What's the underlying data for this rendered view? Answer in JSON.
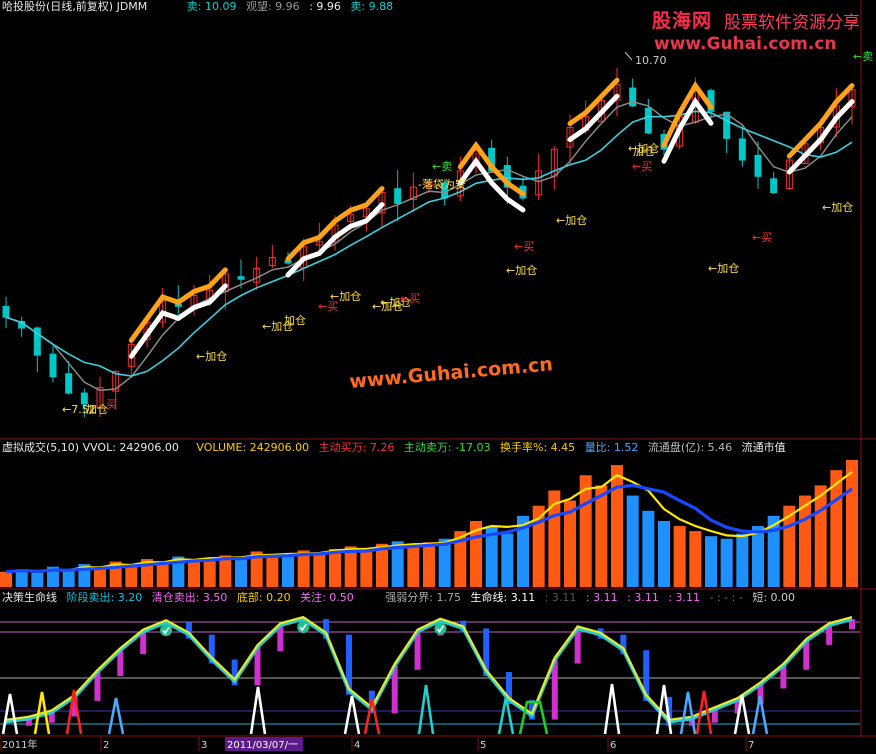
{
  "header": {
    "title": "哈投股份(日线,前复权) JDMM",
    "sell_label": "卖: 10.09",
    "watch_label": "观望: 9.96",
    "mid_label": ": 9.96",
    "sell2_label": "卖: 9.88"
  },
  "watermark": {
    "logo": "股海网",
    "tagline": "股票软件资源分享",
    "url": "www.Guhai.com.cn"
  },
  "main_panel": {
    "high_label": "10.70",
    "center_watermark": "www.Guhai.com.cn",
    "annotations": [
      "←7.52",
      "加仓",
      "买",
      "←加仓",
      "←加仓",
      "加仓",
      "←加仓",
      "←买",
      "←加仓",
      "←加仓",
      "←买",
      "←加仓",
      "←买",
      "←加仓",
      "←加仓",
      "←卖",
      "-落袋为安",
      "加仓",
      "←买",
      "←加仓",
      "←买",
      "←加仓",
      "←卖"
    ],
    "colors": {
      "up": "#ff2a2a",
      "down": "#00c8c8",
      "ma_cyan": "#3ad0e0",
      "ma_gray": "#8a8a8a",
      "orange": "#ffa21a",
      "white": "#ffffff"
    }
  },
  "volume_panel": {
    "title": "虚拟成交(5,10) VVOL: 242906.00",
    "volume": "VOLUME: 242906.00",
    "active_buy": "主动买万: 7.26",
    "active_sell": "主动卖万: -17.03",
    "turnover": "换手率%: 4.45",
    "vol_ratio": "量比: 1.52",
    "float_shares": "流通盘(亿): 5.46",
    "float_cap": "流通市值"
  },
  "life_panel": {
    "title": "决策生命线",
    "stage_sell": "阶段卖出: 3.20",
    "clear_sell": "清仓卖出: 3.50",
    "bottom": "底部: 0.20",
    "watch": "关注: 0.50",
    "strength": "强弱分界: 1.75",
    "lifeline": "生命线: 3.11",
    "v1": ": 3.11",
    "v2": ": 3.11",
    "v3": ": 3.11",
    "v4": ": 3.11",
    "dashes": "- : - : -",
    "short": "短: 0.00"
  },
  "x_axis": {
    "labels": [
      "2011年",
      "2",
      "3",
      "2011/03/07/一",
      "4",
      "5",
      "6",
      "7"
    ]
  },
  "chart_data": {
    "type": "candlestick",
    "price_range": [
      7.3,
      11.0
    ],
    "high": 10.7,
    "low": 7.52,
    "close_samples": [
      8.35,
      8.25,
      8.0,
      7.8,
      7.65,
      7.55,
      7.7,
      7.85,
      8.1,
      8.3,
      8.5,
      8.45,
      8.55,
      8.6,
      8.75,
      8.7,
      8.8,
      8.9,
      8.85,
      9.0,
      9.05,
      9.2,
      9.3,
      9.35,
      9.5,
      9.4,
      9.55,
      9.6,
      9.45,
      9.7,
      9.9,
      9.7,
      9.55,
      9.45,
      9.7,
      9.9,
      10.1,
      10.2,
      10.35,
      10.5,
      10.3,
      10.05,
      9.9,
      10.2,
      10.45,
      10.25,
      10.0,
      9.8,
      9.65,
      9.5,
      9.8,
      9.95,
      10.1,
      10.3,
      10.45
    ],
    "volume_samples": [
      30,
      35,
      28,
      40,
      32,
      45,
      38,
      50,
      42,
      55,
      48,
      60,
      52,
      58,
      62,
      55,
      70,
      65,
      60,
      72,
      68,
      75,
      80,
      70,
      85,
      90,
      78,
      88,
      95,
      110,
      130,
      120,
      105,
      140,
      160,
      190,
      170,
      220,
      200,
      240,
      180,
      150,
      130,
      120,
      110,
      100,
      95,
      105,
      120,
      140,
      160,
      180,
      200,
      230,
      250
    ],
    "lifeline_samples": [
      0.2,
      0.3,
      0.5,
      1.0,
      1.8,
      2.5,
      3.1,
      3.4,
      3.0,
      2.2,
      1.5,
      2.6,
      3.3,
      3.5,
      3.0,
      1.2,
      0.6,
      2.0,
      3.1,
      3.45,
      3.2,
      1.8,
      0.9,
      0.4,
      2.2,
      3.2,
      3.0,
      2.5,
      1.0,
      0.2,
      0.3,
      0.6,
      0.9,
      1.4,
      2.0,
      2.8,
      3.3,
      3.5
    ]
  }
}
